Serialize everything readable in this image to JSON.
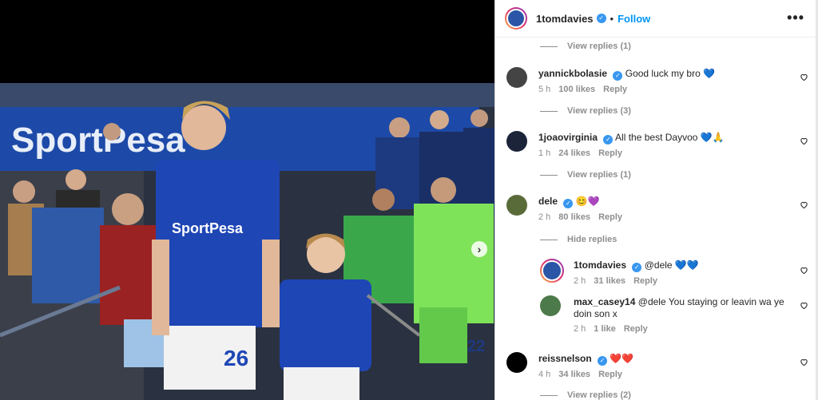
{
  "post": {
    "username": "1tomdavies",
    "follow_label": "Follow",
    "more_label": "•••"
  },
  "photo": {
    "banner_text": "SportPesa",
    "player_number": "26",
    "kid_number": "22"
  },
  "comments": [
    {
      "type": "view_replies",
      "label": "View replies (1)"
    },
    {
      "type": "comment",
      "user": "yannickbolasie",
      "text": "Good luck my bro 💙",
      "time": "5 h",
      "likes": "100 likes",
      "reply": "Reply"
    },
    {
      "type": "view_replies",
      "label": "View replies (3)"
    },
    {
      "type": "comment",
      "user": "1joaovirginia",
      "text": "All the best Dayvoo 💙🙏",
      "time": "1 h",
      "likes": "24 likes",
      "reply": "Reply"
    },
    {
      "type": "view_replies",
      "label": "View replies (1)"
    },
    {
      "type": "comment",
      "user": "dele",
      "text": "😊💜",
      "time": "2 h",
      "likes": "80 likes",
      "reply": "Reply"
    },
    {
      "type": "view_replies",
      "label": "Hide replies"
    },
    {
      "type": "reply",
      "user": "1tomdavies",
      "text": "@dele 💙💙",
      "time": "2 h",
      "likes": "31 likes",
      "reply": "Reply"
    },
    {
      "type": "reply",
      "user": "max_casey14",
      "text": "@dele You staying or leavin wa ye doin son x",
      "time": "2 h",
      "likes": "1 like",
      "reply": "Reply"
    },
    {
      "type": "comment",
      "user": "reissnelson",
      "text": "❤️❤️",
      "time": "4 h",
      "likes": "34 likes",
      "reply": "Reply"
    },
    {
      "type": "view_replies",
      "label": "View replies (2)"
    }
  ]
}
